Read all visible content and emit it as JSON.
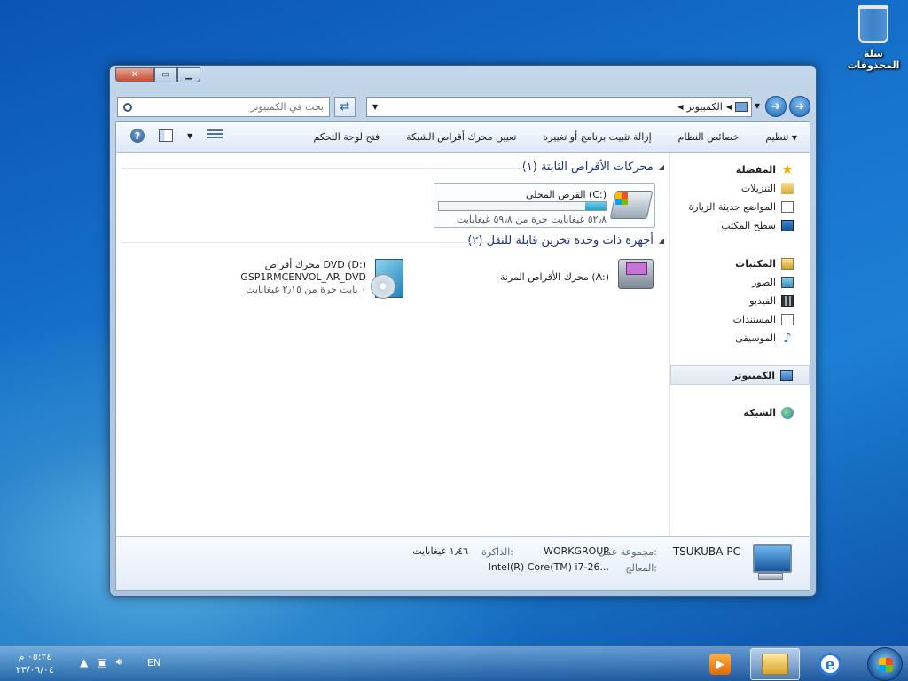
{
  "desktop": {
    "recycle_bin": "سلة المحذوفات"
  },
  "window": {
    "address": {
      "crumb": "الكمبيوتر"
    },
    "search": {
      "placeholder": "بحث في الكمبيوتر"
    },
    "toolbar": {
      "organize": "تنظيم",
      "system_properties": "خصائص النظام",
      "uninstall": "إزالة تثبيت برنامج أو تغييره",
      "map_drive": "تعيين محرك أقراص الشبكة",
      "control_panel": "فتح لوحة التحكم"
    },
    "nav": {
      "favorites": "المفضلة",
      "downloads": "التنزيلات",
      "recent": "المواضع حديثة الزيارة",
      "desktop": "سطح المكتب",
      "libraries": "المكتبات",
      "pictures": "الصور",
      "videos": "الفيديو",
      "documents": "المستندات",
      "music": "الموسيقى",
      "computer": "الكمبيوتر",
      "network": "الشبكة"
    },
    "groups": {
      "hdd": "محركات الأقراص الثابتة (١)",
      "removable": "أجهزة ذات وحدة تخزين قابلة للنقل (٢)"
    },
    "drives": {
      "c": {
        "name": "القرص المحلي (C:)",
        "free": "٥٢٫٨ غيغابايت حرة من ٥٩٫٨ غيغابايت",
        "used_fraction": 0.12
      },
      "a": {
        "name": "محرك الأقراص المرنة (A:)"
      },
      "d": {
        "name": "محرك أقراص DVD (D:)",
        "label": "GSP1RMCENVOL_AR_DVD",
        "free": "٠ بايت حرة من ٢٫١٥ غيغابايت"
      }
    },
    "details": {
      "pc_name": "TSUKUBA-PC",
      "workgroup_label": "مجموعة عمل:",
      "workgroup": "WORKGROUP",
      "memory_label": "الذاكرة:",
      "memory": "١٫٤٦ غيغابايت",
      "processor_label": "المعالج:",
      "processor": "Intel(R) Core(TM) i7-26..."
    }
  },
  "taskbar": {
    "lang": "EN",
    "time": "٠٥:٢٤ م",
    "date": "٢٣/٠٦/٠٤"
  }
}
